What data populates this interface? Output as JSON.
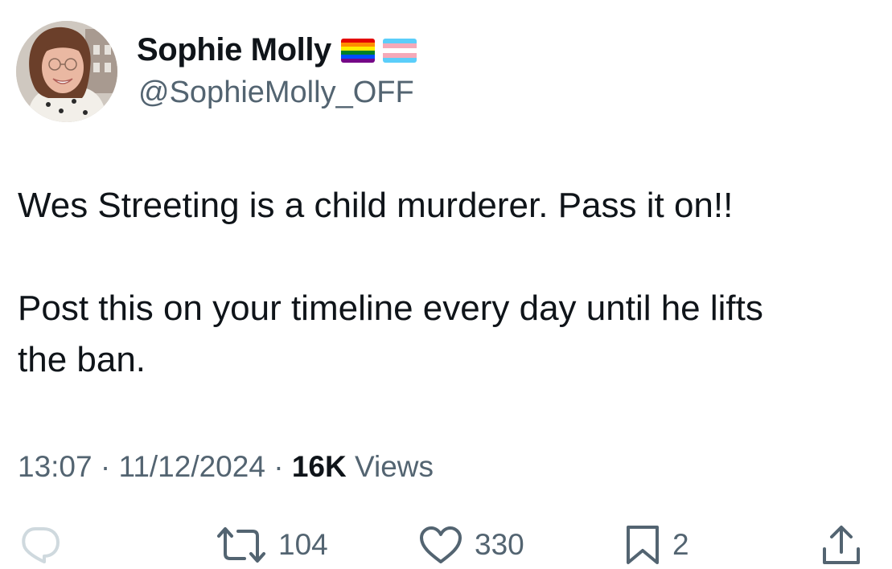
{
  "author": {
    "display_name": "Sophie Molly",
    "handle": "@SophieMolly_OFF",
    "badges": [
      "rainbow-flag",
      "transgender-flag"
    ]
  },
  "tweet": {
    "paragraphs": [
      "Wes Streeting is a child murderer. Pass it on!!",
      "Post this on your timeline every day until he lifts\nthe ban."
    ]
  },
  "meta": {
    "time": "13:07",
    "separator": " · ",
    "date": "11/12/2024",
    "views_count": "16K",
    "views_label": " Views"
  },
  "actions": {
    "reply": {
      "icon": "reply-icon"
    },
    "retweet": {
      "icon": "retweet-icon",
      "count": "104"
    },
    "like": {
      "icon": "heart-icon",
      "count": "330"
    },
    "bookmark": {
      "icon": "bookmark-icon",
      "count": "2"
    },
    "share": {
      "icon": "share-icon"
    }
  },
  "colors": {
    "text_primary": "#0f1419",
    "text_secondary": "#536471",
    "reply_icon": "#cfd9de"
  }
}
